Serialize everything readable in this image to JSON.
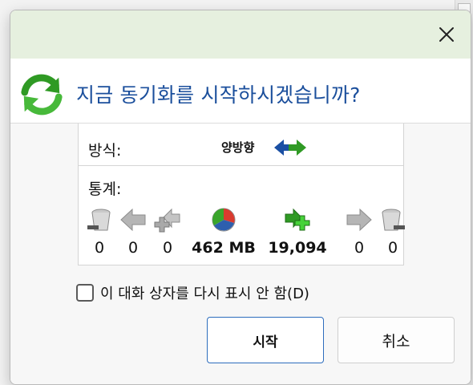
{
  "dialog": {
    "heading": "지금 동기화를 시작하시겠습니까?",
    "method_label": "방식:",
    "method_value": "양방향",
    "stats_label": "통계:",
    "stats": [
      {
        "icon": "delete-left-icon",
        "value": "0"
      },
      {
        "icon": "arrow-left-icon",
        "value": "0"
      },
      {
        "icon": "add-left-icon",
        "value": "0"
      },
      {
        "icon": "data-pie-icon",
        "value": "462 MB"
      },
      {
        "icon": "add-right-icon",
        "value": "19,094"
      },
      {
        "icon": "arrow-right-icon",
        "value": "0"
      },
      {
        "icon": "delete-right-icon",
        "value": "0"
      }
    ],
    "checkbox_label": "이 대화 상자를 다시 표시 안 함(D)",
    "checkbox_checked": false,
    "start_label": "시작",
    "cancel_label": "취소"
  },
  "colors": {
    "titlebar_bg": "#e6f0df",
    "heading_text": "#1b4f9c",
    "primary_border": "#2d6dbd",
    "sync_green": "#3aa52b"
  }
}
